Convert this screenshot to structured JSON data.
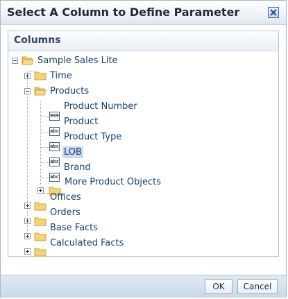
{
  "dialog": {
    "title": "Select A Column to Define Parameter",
    "close_icon": "close-x-icon"
  },
  "panel": {
    "title": "Columns"
  },
  "tree": {
    "root": "Sample Sales Lite",
    "time": "Time",
    "products": "Products",
    "product_number": "Product Number",
    "product": "Product",
    "product_type": "Product Type",
    "lob": "LOB",
    "brand": "Brand",
    "more_product_objects": "More Product Objects",
    "offices": "Offices",
    "orders": "Orders",
    "base_facts": "Base Facts",
    "calculated_facts": "Calculated Facts",
    "numeric_badge": "999",
    "text_badge": "abc",
    "selected_item": "LOB"
  },
  "buttons": {
    "ok": "OK",
    "cancel": "Cancel"
  },
  "colors": {
    "folder": "#f3d374",
    "folder_border": "#c9a43c",
    "selection": "#c9daf4",
    "link_text": "#16406f"
  }
}
